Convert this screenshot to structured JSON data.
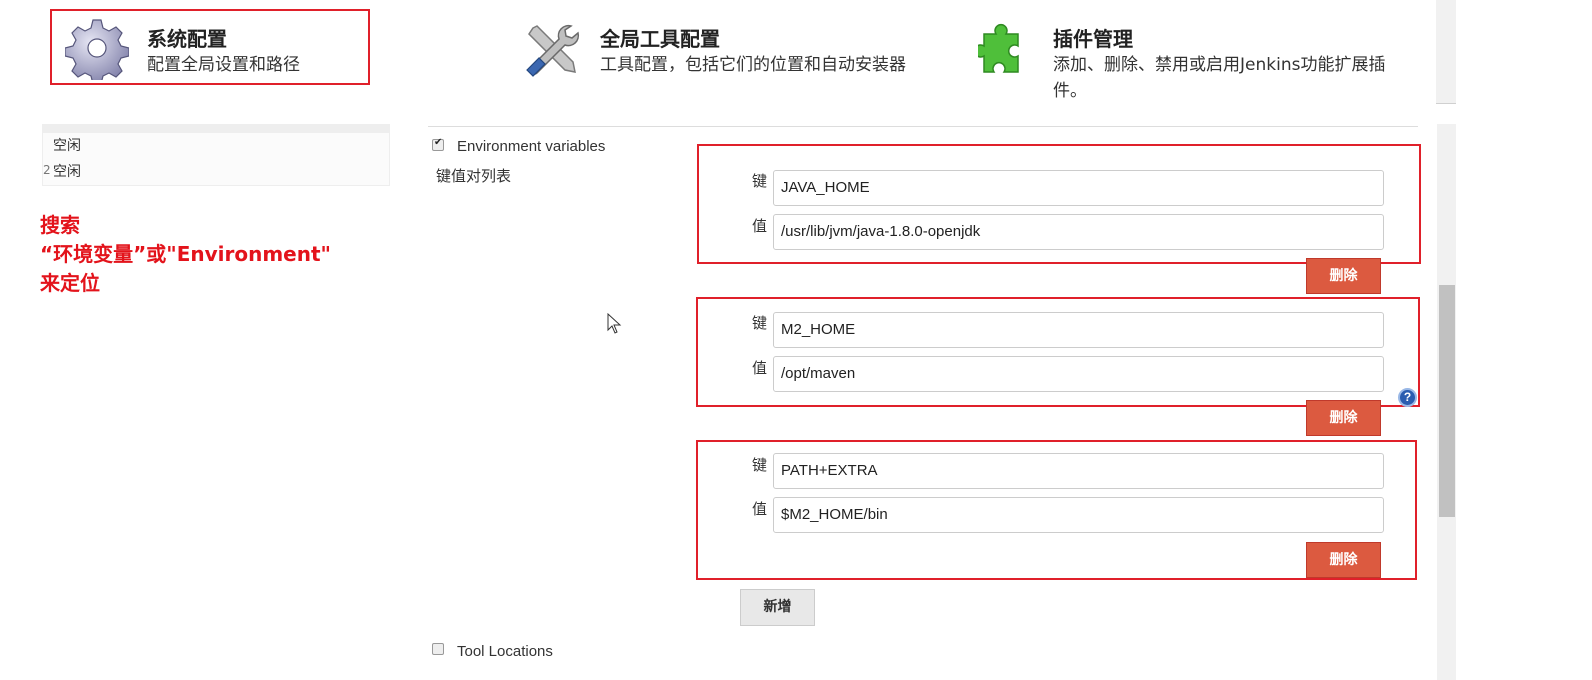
{
  "top_items": [
    {
      "title": "系统配置",
      "desc": "配置全局设置和路径",
      "icon": "gear-icon"
    },
    {
      "title": "全局工具配置",
      "desc": "工具配置，包括它们的位置和自动安装器",
      "icon": "tools-icon"
    },
    {
      "title": "插件管理",
      "desc": "添加、删除、禁用或启用Jenkins功能扩展插件。",
      "icon": "puzzle-icon"
    }
  ],
  "sidebar": {
    "executors": [
      {
        "prefix": "",
        "status": "空闲"
      },
      {
        "prefix": "2",
        "status": "空闲"
      }
    ]
  },
  "annotation": {
    "line1": "搜索",
    "line2": "“环境变量”或\"Environment\"",
    "line3": "来定位"
  },
  "env_section": {
    "checkbox_label": "Environment variables",
    "checked": true,
    "list_label": "键值对列表",
    "key_label": "键",
    "value_label": "值",
    "delete_label": "删除",
    "add_label": "新增",
    "entries": [
      {
        "key": "JAVA_HOME",
        "value": "/usr/lib/jvm/java-1.8.0-openjdk"
      },
      {
        "key": "M2_HOME",
        "value": "/opt/maven"
      },
      {
        "key": "PATH+EXTRA",
        "value": "$M2_HOME/bin"
      }
    ]
  },
  "tool_locations": {
    "label": "Tool Locations",
    "checked": false
  },
  "help_icon": "?",
  "colors": {
    "highlight": "#e0202a",
    "annotation": "#e3131b",
    "delete": "#dc5a40"
  }
}
